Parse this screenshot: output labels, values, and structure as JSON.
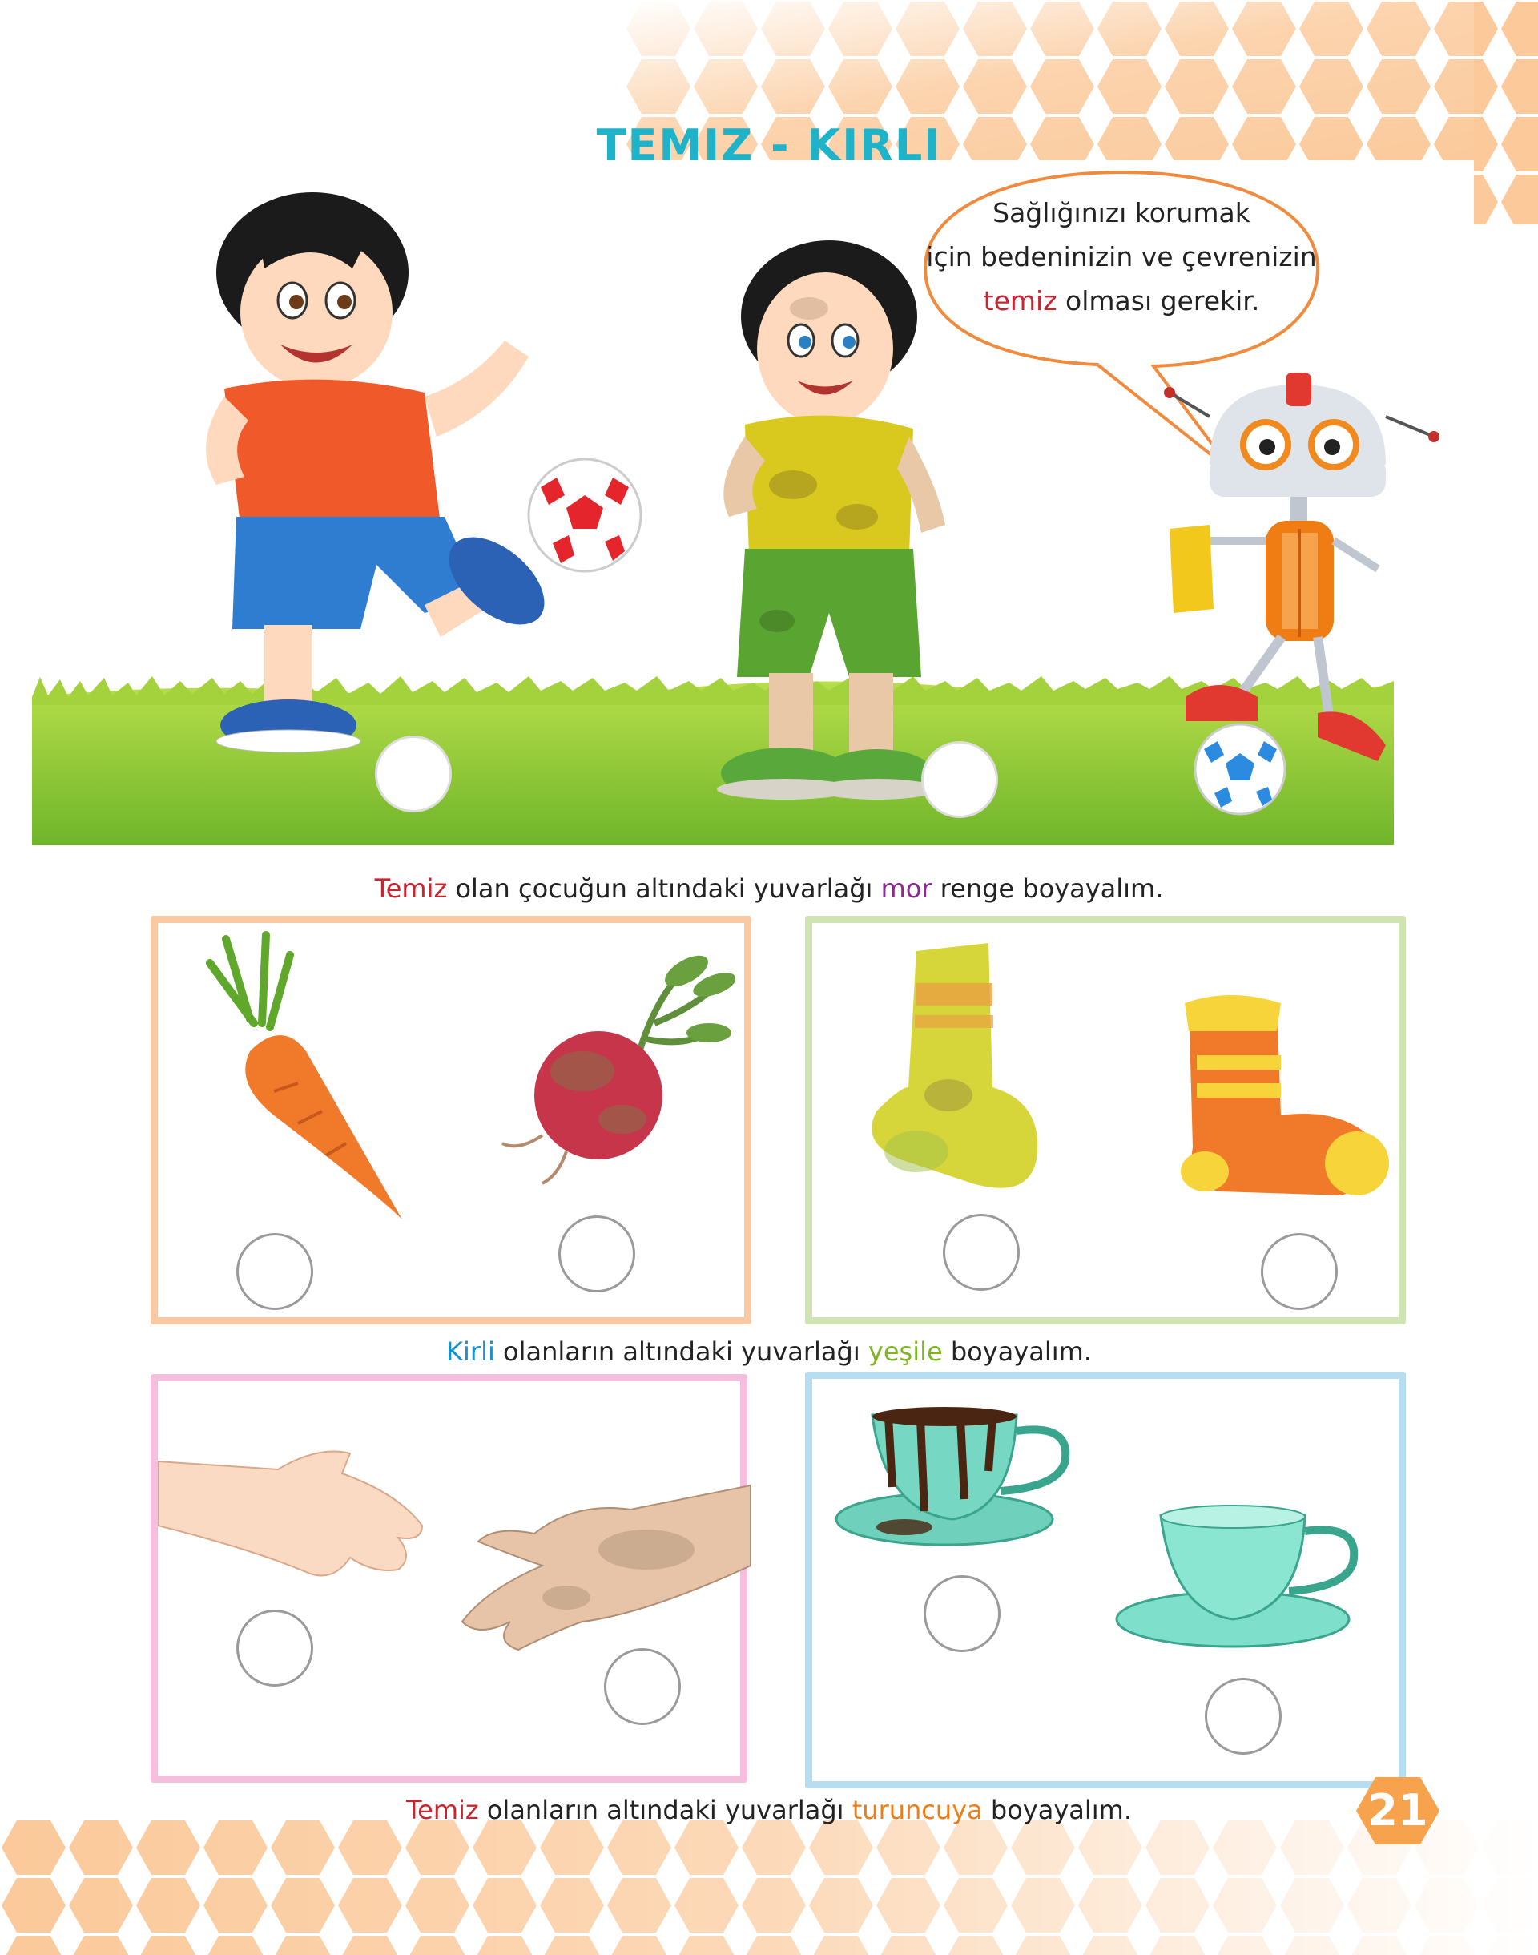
{
  "page": {
    "title": "TEMIZ - KIRLI",
    "speech_bubble": {
      "line1": "Sağlığınızı korumak",
      "line2": "için bedeninizin ve çevrenizin",
      "line3_highlight": "temiz",
      "line3_rest": " olması gerekir."
    },
    "instruction_1": {
      "highlight": "Temiz",
      "part1": " olan çocuğun altındaki yuvarlağı ",
      "color_word": "mor",
      "part2": " renge boyayalım."
    },
    "instruction_2": {
      "highlight": "Kirli",
      "part1": " olanların altındaki yuvarlağı ",
      "color_word": "yeşile",
      "part2": " boyayalım."
    },
    "instruction_3": {
      "highlight": "Temiz",
      "part1": " olanların altındaki yuvarlağı ",
      "color_word": "turuncuya",
      "part2": " boyayalım."
    },
    "page_number": "21"
  },
  "illustrations": {
    "scene": [
      "clean-boy-kicking-ball",
      "dirty-boy",
      "robot-with-towel",
      "grass-field"
    ],
    "box1": [
      "clean-carrot",
      "dirty-beet"
    ],
    "box2": [
      "dirty-sock",
      "clean-sock"
    ],
    "box3": [
      "clean-hand",
      "dirty-hand"
    ],
    "box4": [
      "dirty-cup",
      "clean-cup"
    ]
  },
  "colors": {
    "title": "#1eb3c9",
    "temiz": "#c8252f",
    "mor": "#8a2a8f",
    "kirli": "#1a8fd0",
    "yesil": "#7fb522",
    "turuncu": "#f07d14",
    "hex_pattern": "#f9b27a"
  }
}
